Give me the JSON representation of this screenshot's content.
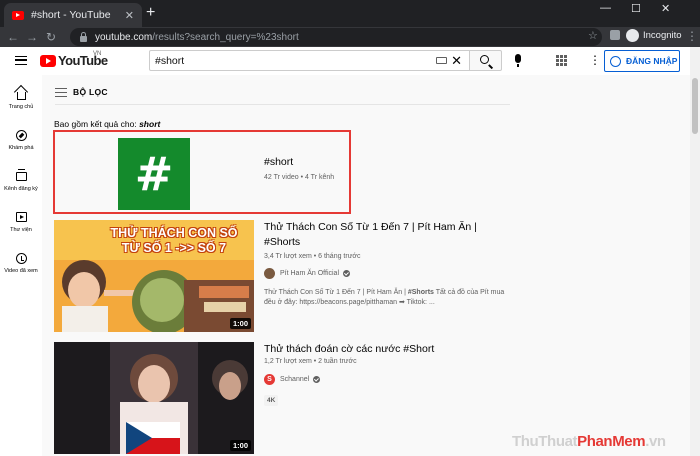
{
  "browser": {
    "tab_title": "#short - YouTube",
    "tab_close": "✕",
    "new_tab": "+",
    "win_min": "—",
    "win_max": "☐",
    "win_close": "✕",
    "back": "←",
    "forward": "→",
    "reload": "↻",
    "url_host": "youtube.com",
    "url_path": "/results?search_query=%23short",
    "bookmark": "☆",
    "profile_label": "Incognito",
    "menu": "⋮"
  },
  "header": {
    "logo_text": "YouTube",
    "logo_region": "VN",
    "search_value": "#short",
    "clear": "✕",
    "more": "⋮",
    "sign_in_label": "ĐĂNG NHẬP"
  },
  "sidebar": {
    "items": [
      {
        "label": "Trang chủ",
        "icon": "home-icon"
      },
      {
        "label": "Khám phá",
        "icon": "compass-icon"
      },
      {
        "label": "Kênh đăng ký",
        "icon": "subscriptions-icon"
      },
      {
        "label": "Thư viện",
        "icon": "library-icon"
      },
      {
        "label": "Video đã xem",
        "icon": "history-icon"
      }
    ]
  },
  "results": {
    "filter_label": "BỘ LỌC",
    "includes_prefix": "Bao gồm kết quả cho:",
    "includes_query": "short",
    "hashtag": {
      "symbol": "#",
      "title": "#short",
      "meta": "42 Tr video • 4 Tr kênh"
    },
    "videos": [
      {
        "title_line1": "Thử Thách Con Số Từ 1 Đến 7 | Pít Ham Ăn |",
        "title_line2": "#Shorts",
        "meta": "3,4 Tr lượt xem • 6 tháng trước",
        "channel": "Pít Ham Ăn Official",
        "desc_prefix": "Thử Thách Con Số Từ 1 Đến 7 | Pít Ham Ăn | ",
        "desc_tag": "#Shorts",
        "desc_rest": " Tất cả đồ của Pít mua đều ở đây: https://beacons.page/pitthaman ➡ Tiktok: ...",
        "thumb_text_line1": "THỬ THÁCH CON SỐ",
        "thumb_text_line2": "TỪ SỐ 1 ->> SỐ 7",
        "duration": "1:00"
      },
      {
        "title_line1": "Thử thách đoán cờ các nước #Short",
        "meta": "1,2 Tr lượt xem • 2 tuần trước",
        "channel": "Schannel",
        "channel_initial": "S",
        "badge": "4K",
        "duration": "1:00"
      }
    ]
  },
  "watermark": {
    "part1": "ThuThuat",
    "part2": "PhanMem",
    "part3": ".vn"
  },
  "colors": {
    "accent_blue": "#065fd4",
    "youtube_red": "#ff0000",
    "highlight_red": "#e53935",
    "hashtag_green": "#148a2c"
  }
}
